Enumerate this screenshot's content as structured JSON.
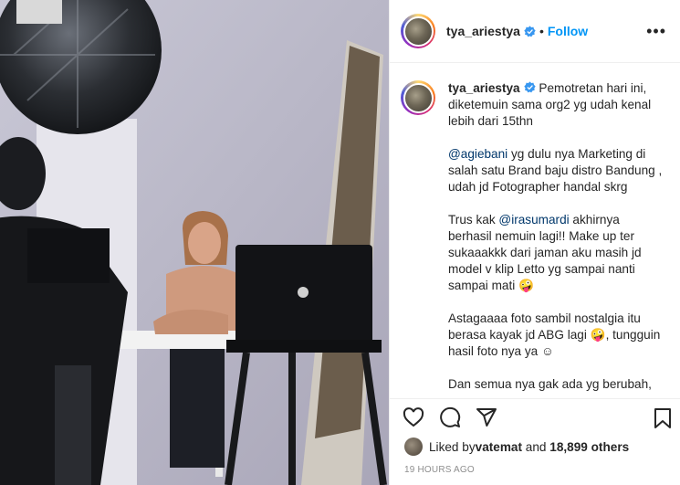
{
  "header": {
    "username": "tya_ariestya",
    "separator": "•",
    "follow_label": "Follow",
    "more_label": "•••"
  },
  "caption": {
    "username": "tya_ariestya",
    "paragraphs": {
      "p1": "Pemotretan hari ini, diketemuin sama org2 yg udah kenal lebih dari 15thn",
      "p2_mention": "@agiebani",
      "p2_text": " yg dulu nya Marketing di salah satu Brand baju distro Bandung , udah jd Fotographer handal skrg",
      "p3_prefix": "Trus kak ",
      "p3_mention": "@irasumardi",
      "p3_text": " akhirnya berhasil nemuin lagi!! Make up ter sukaaakkk dari jaman aku masih jd model v klip Letto yg sampai nanti sampai mati 🤪",
      "p4": "Astagaaaa foto sambil nostalgia itu berasa kayak jd ABG lagi 🤪, tungguin hasil foto nya ya ☺",
      "p5": "Dan semua nya gak ada yg berubah,"
    }
  },
  "likes": {
    "prefix": "Liked by ",
    "user": "vatemat",
    "middle": " and ",
    "count": "18,899 others"
  },
  "timestamp": "19 HOURS AGO",
  "icons": {
    "verified": "verified-badge-icon",
    "like": "heart-icon",
    "comment": "comment-icon",
    "share": "paper-plane-icon",
    "save": "bookmark-icon"
  },
  "colors": {
    "accent": "#0095f6",
    "mention": "#00376b",
    "muted": "#8e8e8e"
  }
}
